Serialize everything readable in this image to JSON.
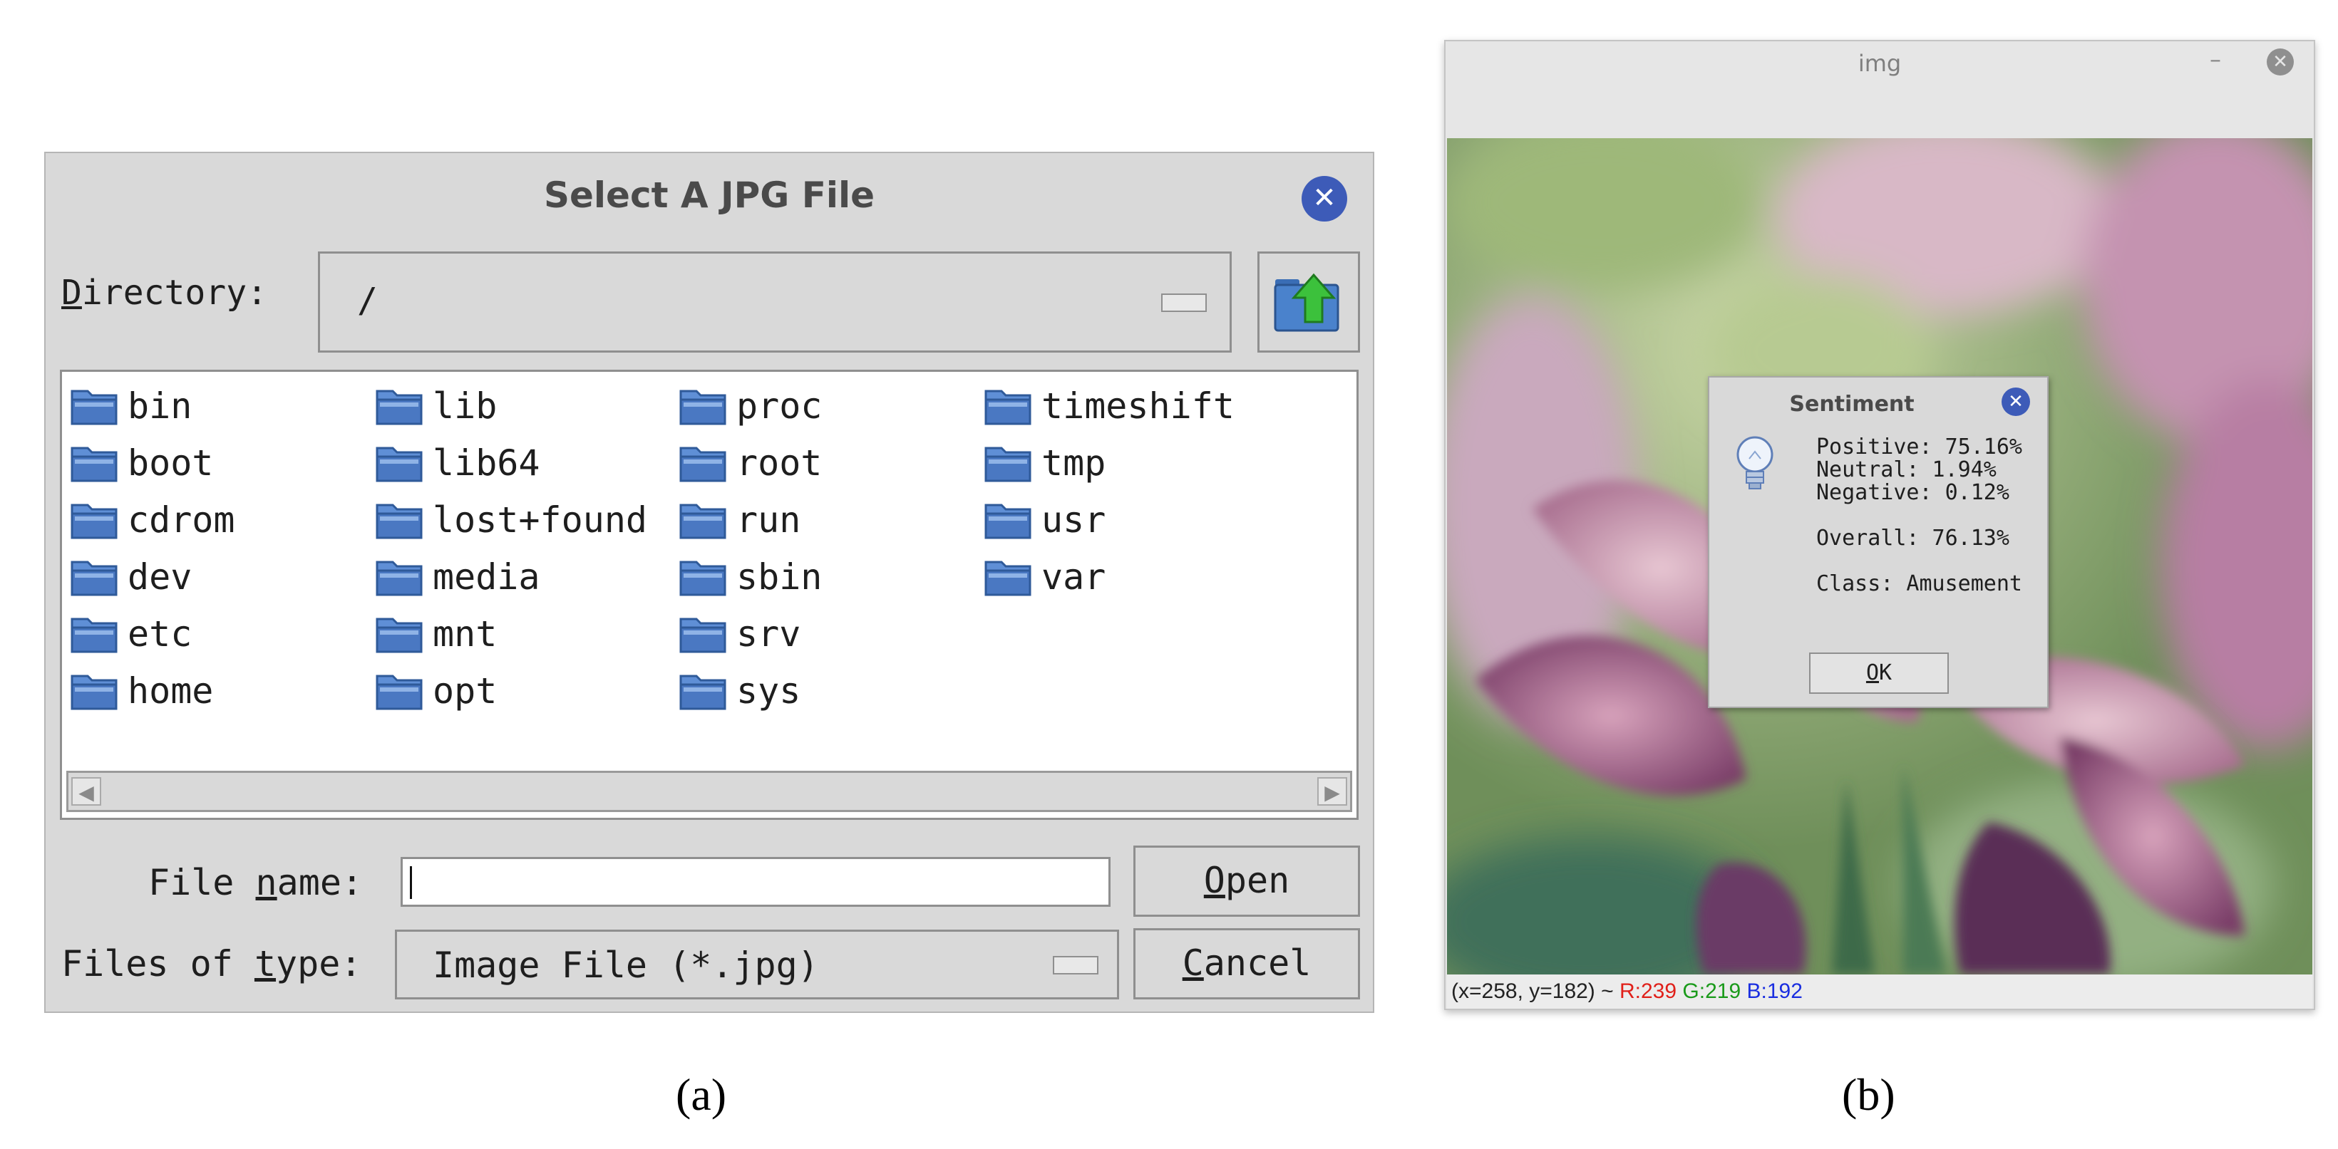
{
  "file_dialog": {
    "title": "Select A JPG File",
    "directory_label_mnemonic": "D",
    "directory_label_rest": "irectory:",
    "directory_value": "/",
    "files": [
      [
        "bin",
        "boot",
        "cdrom",
        "dev",
        "etc",
        "home"
      ],
      [
        "lib",
        "lib64",
        "lost+found",
        "media",
        "mnt",
        "opt"
      ],
      [
        "proc",
        "root",
        "run",
        "sbin",
        "srv",
        "sys"
      ],
      [
        "timeshift",
        "tmp",
        "usr",
        "var"
      ]
    ],
    "file_name_label_pre": "File ",
    "file_name_label_mnemonic": "n",
    "file_name_label_post": "ame:",
    "file_name_value": "",
    "files_of_type_label_pre": "Files of ",
    "files_of_type_label_mnemonic": "t",
    "files_of_type_label_post": "ype:",
    "files_of_type_value": "Image File (*.jpg)",
    "open_mnemonic": "O",
    "open_rest": "pen",
    "cancel_mnemonic": "C",
    "cancel_rest": "ancel",
    "caption": "(a)"
  },
  "image_window": {
    "title": "img",
    "minimize_glyph": "–",
    "status": {
      "coords": "(x=258, y=182) ~ ",
      "r": "R:239",
      "g": "G:219",
      "b": "B:192"
    },
    "status_colors": {
      "r": "#e0201a",
      "g": "#1a9a1a",
      "b": "#1a2ee0"
    },
    "caption": "(b)"
  },
  "sentiment_dialog": {
    "title": "Sentiment",
    "positive": "Positive: 75.16%",
    "neutral": "Neutral: 1.94%",
    "negative": "Negative: 0.12%",
    "overall": "Overall: 76.13%",
    "class": "Class: Amusement",
    "ok_mnemonic": "O",
    "ok_rest": "K"
  },
  "colors": {
    "dialog_bg": "#d9d9d9",
    "accent_close": "#3d5bb8",
    "folder_blue": "#4a78c2"
  }
}
